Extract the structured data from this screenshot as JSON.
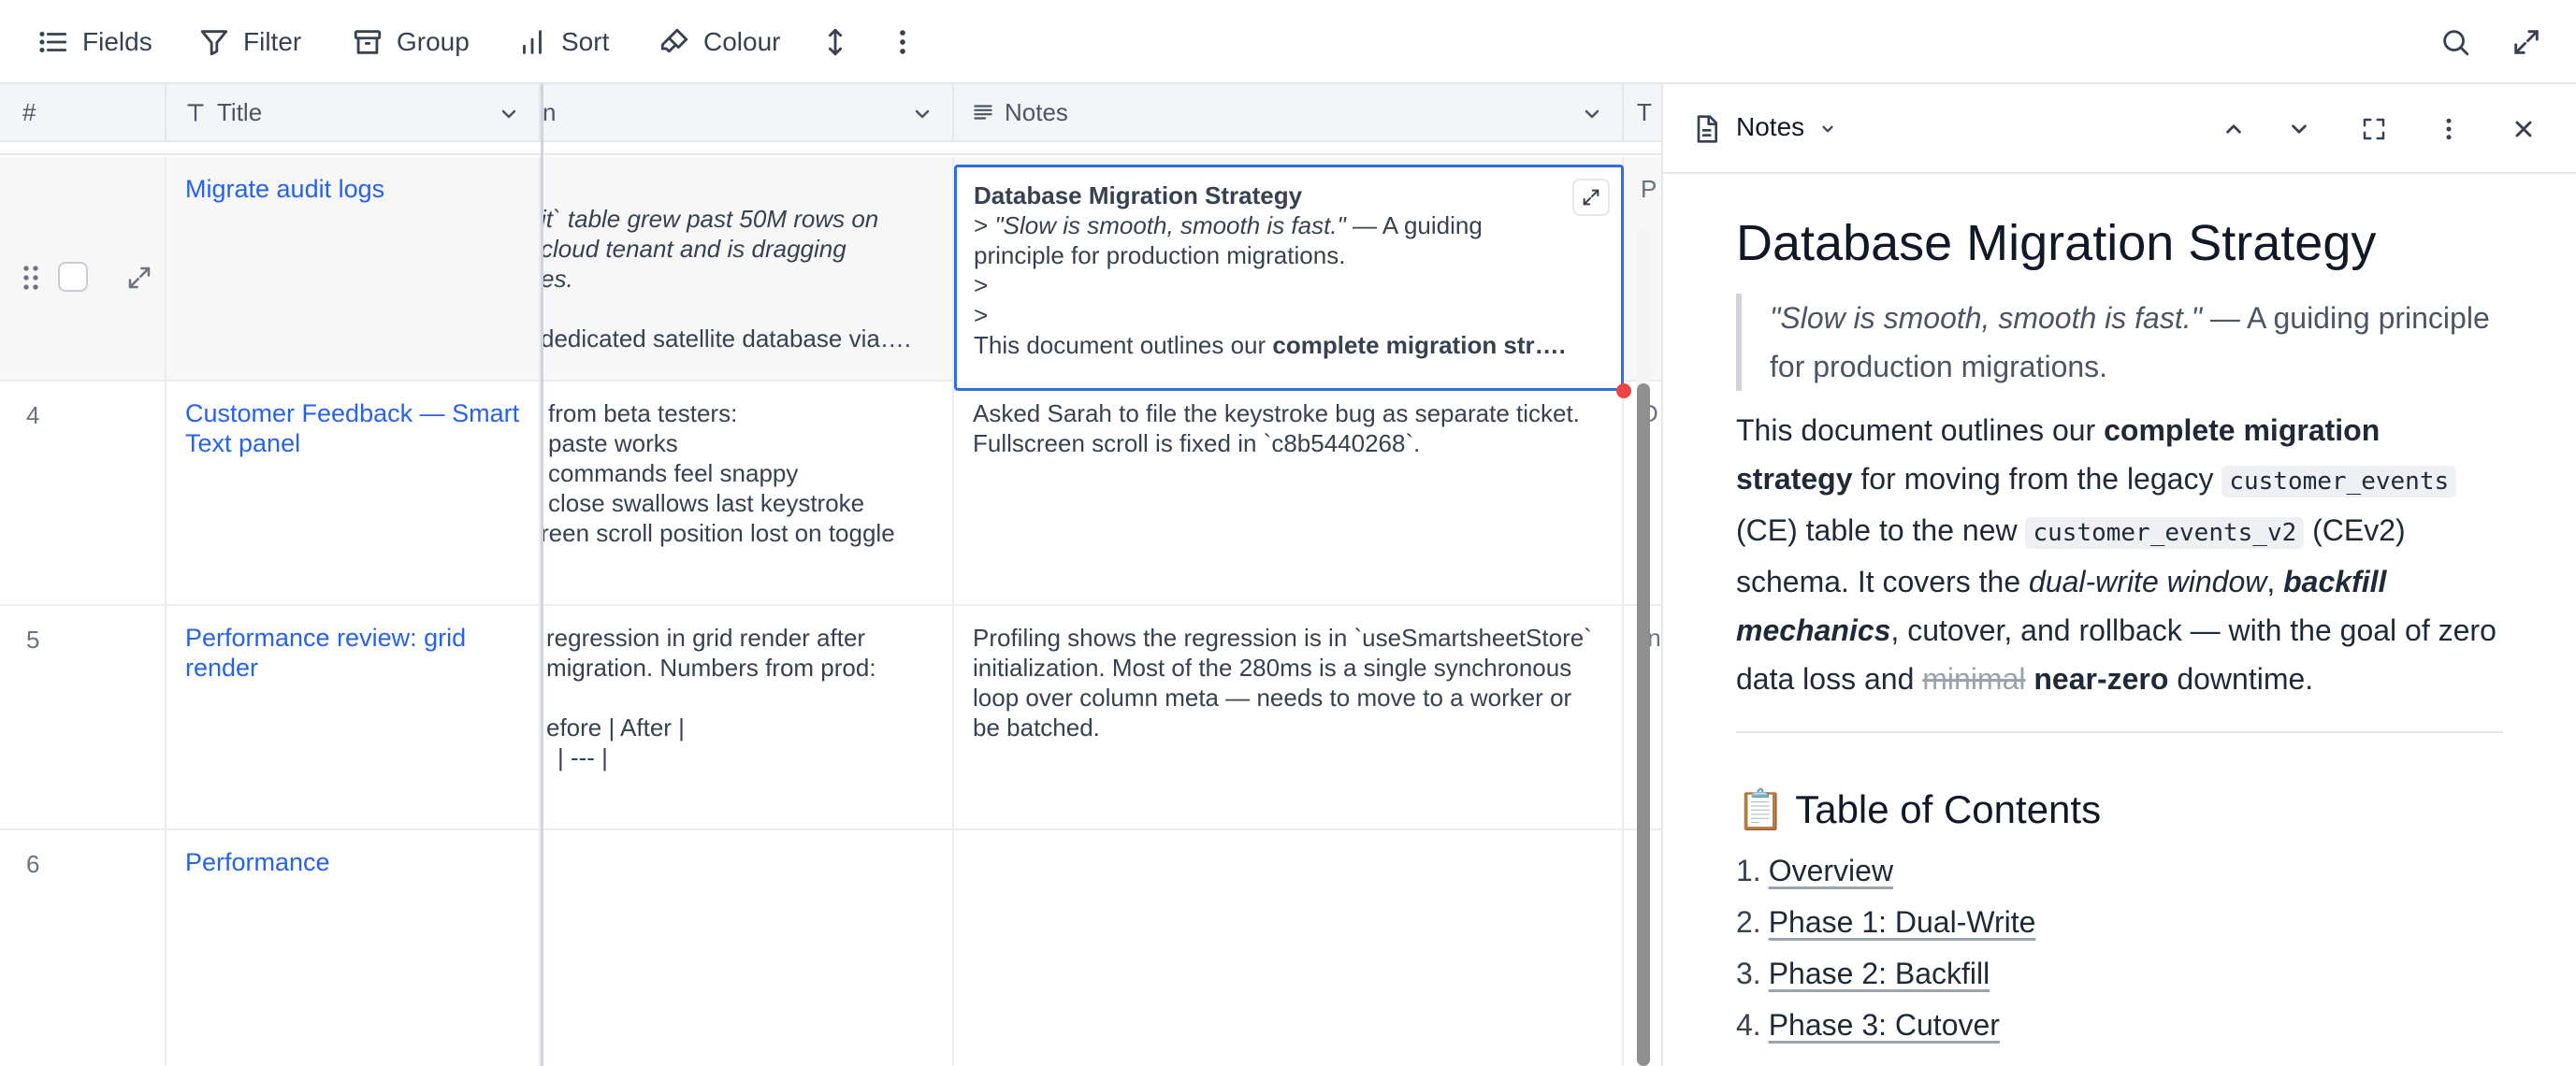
{
  "toolbar": {
    "fields": "Fields",
    "filter": "Filter",
    "group": "Group",
    "sort": "Sort",
    "colour": "Colour"
  },
  "grid": {
    "headers": {
      "number": "#",
      "title": "Title",
      "description_fragment": "n",
      "notes": "Notes",
      "extra": "T"
    },
    "rows": [
      {
        "number": "",
        "title": "Migrate audit logs",
        "description_lines": [
          "it` table grew past 50M rows on",
          "cloud tenant and is dragging",
          "es.",
          "",
          "dedicated satellite database via…."
        ],
        "extra": "P"
      },
      {
        "number": "4",
        "title": "Customer Feedback — Smart Text panel",
        "description_lines": [
          "from beta testers:",
          "paste works",
          "commands feel snappy",
          "close swallows last keystroke",
          "reen scroll position lost on toggle"
        ],
        "notes": "Asked Sarah to file the keystroke bug as separate ticket. Fullscreen scroll is fixed in `c8b5440268`.",
        "extra": "D"
      },
      {
        "number": "5",
        "title": "Performance review: grid render",
        "description_lines": [
          "regression in grid render after",
          "migration. Numbers from prod:",
          "",
          "efore | After |",
          "| --- |"
        ],
        "notes": "Profiling shows the regression is in `useSmartsheetStore` initialization. Most of the 280ms is a single synchronous loop over column meta — needs to move to a worker or be batched.",
        "extra": "In"
      },
      {
        "number": "6",
        "title": "Performance",
        "description_lines": [],
        "notes": "",
        "extra": ""
      }
    ],
    "active_cell": {
      "title": "Database Migration Strategy",
      "line1_prefix": "> ",
      "line1_quote": "\"Slow is smooth, smooth is fast.\"",
      "line1_rest": " — A guiding",
      "line2": "principle for production migrations.",
      "line3": ">",
      "line4": ">",
      "line5_prefix": "This document outlines our ",
      "line5_bold": "complete migration str…."
    }
  },
  "panel": {
    "header_title": "Notes",
    "doc": {
      "heading": "Database Migration Strategy",
      "quote_italic": "\"Slow is smooth, smooth is fast.\"",
      "quote_rest": " — A guiding principle for production migrations.",
      "p_1": "This document outlines our ",
      "p_bold_1": "complete migration strategy",
      "p_2": " for moving from the legacy ",
      "p_code_1": "customer_events",
      "p_3": " (CE) table to the new ",
      "p_code_2": "customer_events_v2",
      "p_4": " (CEv2) schema. It covers the ",
      "p_italic_1": "dual-write window",
      "p_5": ", ",
      "p_bold_italic": "backfill mechanics",
      "p_6": ", cutover, and rollback — with the goal of zero data loss and ",
      "p_strike": "minimal",
      "p_7": " ",
      "p_bold_2": "near-zero",
      "p_8": " downtime.",
      "toc_heading": "📋 Table of Contents",
      "toc": [
        {
          "n": "1.",
          "label": "Overview"
        },
        {
          "n": "2.",
          "label": "Phase 1: Dual-Write"
        },
        {
          "n": "3.",
          "label": "Phase 2: Backfill"
        },
        {
          "n": "4.",
          "label": "Phase 3: Cutover"
        }
      ]
    }
  },
  "colors": {
    "accent": "#2563eb",
    "active_border": "#2f6fe4",
    "fill_handle": "#ef4444"
  }
}
